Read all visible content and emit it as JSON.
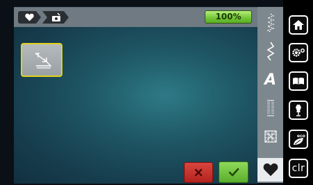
{
  "breadcrumb": {
    "items": [
      "heart-icon",
      "camera-icon"
    ]
  },
  "status": {
    "battery_label": "100%"
  },
  "content": {
    "tile_icon": "resize-arrow-icon"
  },
  "actions": {
    "cancel_icon": "close-icon",
    "confirm_icon": "check-icon"
  },
  "modes": [
    "practical-stitch-icon",
    "decorative-stitch-icon",
    "alphabet-icon",
    "buttonhole-icon",
    "quilt-stitch-icon",
    "heart-icon"
  ],
  "modes_letter": "A",
  "rightbar": {
    "home_icon": "home-icon",
    "settings_icon": "settings-gear-icon",
    "guide_icon": "book-icon",
    "consult_icon": "dressform-icon",
    "eco_label": "eco",
    "clr_label": "clr"
  },
  "colors": {
    "battery": "#76c83a",
    "cancel": "#c8302a",
    "confirm": "#6cc23a",
    "tile_border": "#e4d21a"
  }
}
